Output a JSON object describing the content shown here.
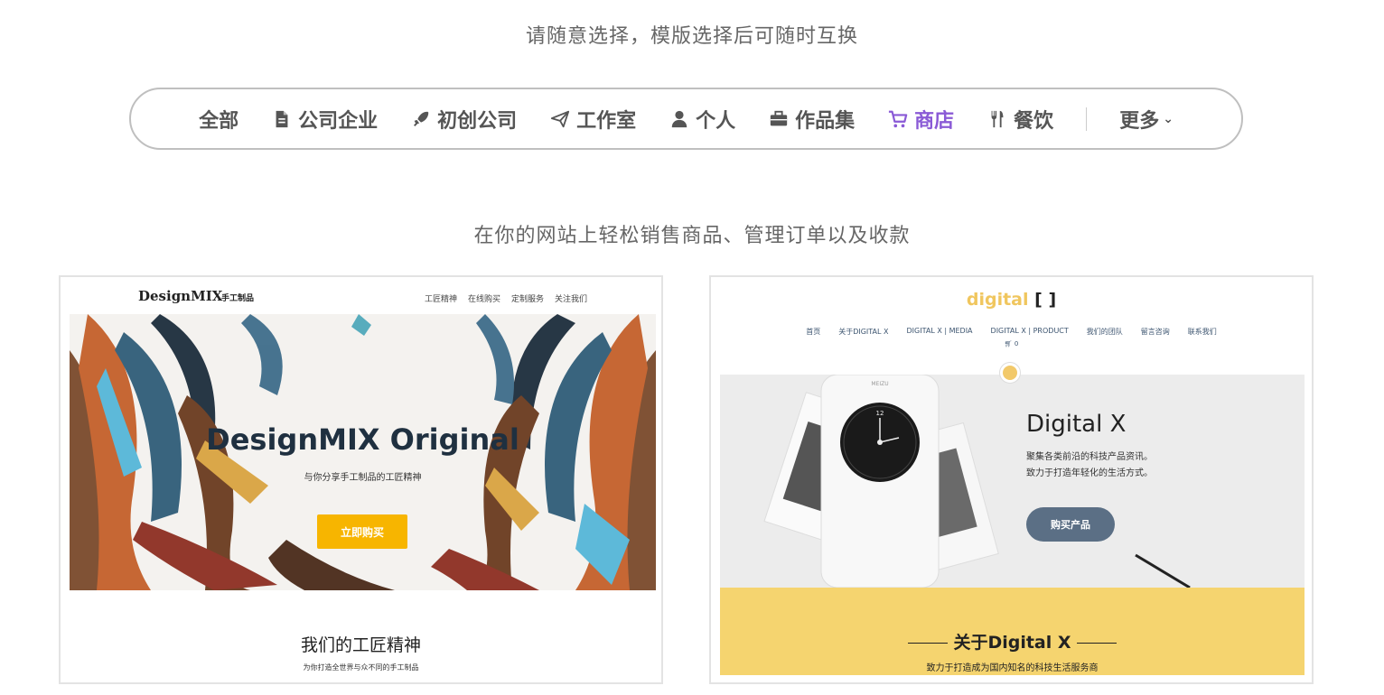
{
  "header": {
    "subtitle": "请随意选择，模版选择后可随时互换"
  },
  "filters": {
    "items": [
      {
        "label": "全部",
        "icon": "none"
      },
      {
        "label": "公司企业",
        "icon": "document-icon"
      },
      {
        "label": "初创公司",
        "icon": "rocket-icon"
      },
      {
        "label": "工作室",
        "icon": "paper-plane-icon"
      },
      {
        "label": "个人",
        "icon": "user-icon"
      },
      {
        "label": "作品集",
        "icon": "briefcase-icon"
      },
      {
        "label": "商店",
        "icon": "cart-icon",
        "active": true
      },
      {
        "label": "餐饮",
        "icon": "fork-knife-icon"
      }
    ],
    "more_label": "更多",
    "active_color": "#8a5ad6"
  },
  "section": {
    "subtitle": "在你的网站上轻松销售商品、管理订单以及收款"
  },
  "templates": [
    {
      "logo": "DesignMIX",
      "logo_sub": "手工制品",
      "nav": [
        "工匠精神",
        "在线购买",
        "定制服务",
        "关注我们"
      ],
      "hero_title": "DesignMIX Original",
      "hero_subtitle": "与你分享手工制品的工匠精神",
      "hero_button": "立即购买",
      "section_title": "我们的工匠精神",
      "section_subtitle": "为你打造全世界与众不同的手工制品",
      "button_color": "#f7b500"
    },
    {
      "logo": "digital",
      "logo_brackets": "[ ]",
      "nav": [
        "首页",
        "关于DIGITAL X",
        "DIGITAL X | MEDIA",
        "DIGITAL X | PRODUCT",
        "我们的团队",
        "留言咨询",
        "联系我们"
      ],
      "cart": "0",
      "hero_title": "Digital X",
      "hero_line1": "聚集各类前沿的科技产品资讯。",
      "hero_line2": "致力于打造年轻化的生活方式。",
      "hero_button": "购买产品",
      "band_title": "关于Digital X",
      "band_subtitle": "致力于打造成为国内知名的科技生活服务商",
      "brand_color": "#f5d46f",
      "button_color": "#5b6f85",
      "watch_face_number": "12",
      "phone_brand": "MEIZU"
    }
  ]
}
